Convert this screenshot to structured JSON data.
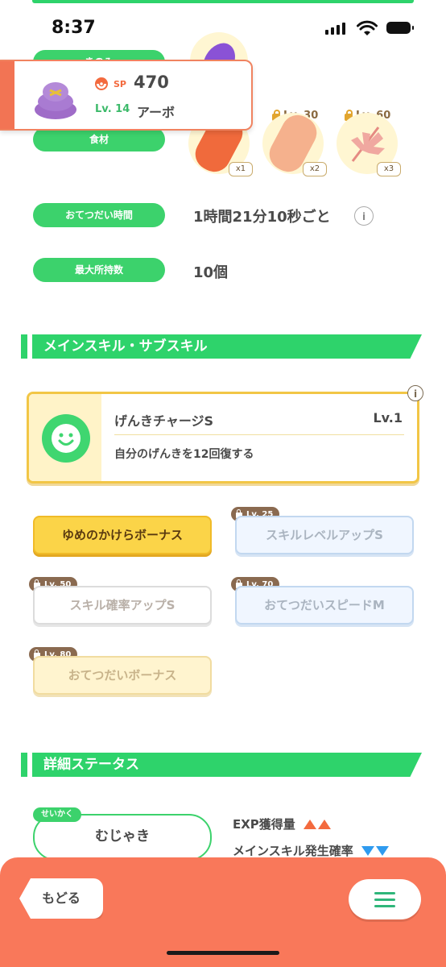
{
  "status_bar": {
    "time": "8:37"
  },
  "popup": {
    "sp_label": "SP",
    "sp_value": "470",
    "level": "Lv. 14",
    "name": "アーボ"
  },
  "info": {
    "label_top": "きのみ",
    "ingredients_label": "食材",
    "help_time_label": "おてつだい時間",
    "help_time_value": "1時間21分10秒ごと",
    "max_carry_label": "最大所持数",
    "max_carry_value": "10個"
  },
  "ingredients": [
    {
      "lock_label": "",
      "qty": "x1",
      "color": "#f06a3c",
      "icon": "sausage-icon"
    },
    {
      "lock_label": "Lv. 30",
      "qty": "x2",
      "color": "#f3a07c",
      "icon": "sausage-icon"
    },
    {
      "lock_label": "Lv. 60",
      "qty": "x3",
      "color": "#f0a8a0",
      "icon": "herb-icon"
    }
  ],
  "section_skill": {
    "title": "メインスキル・サブスキル"
  },
  "main_skill": {
    "name": "げんきチャージS",
    "level": "Lv.1",
    "description": "自分のげんきを12回復する",
    "info_glyph": "i"
  },
  "sub_skills": [
    {
      "label": "ゆめのかけらボーナス",
      "lock": "",
      "style": "active"
    },
    {
      "label": "スキルレベルアップS",
      "lock": "Lv. 25",
      "style": "blue"
    },
    {
      "label": "スキル確率アップS",
      "lock": "Lv. 50",
      "style": "white"
    },
    {
      "label": "おてつだいスピードM",
      "lock": "Lv. 70",
      "style": "blue"
    },
    {
      "label": "おてつだいボーナス",
      "lock": "Lv. 80",
      "style": "yellow"
    }
  ],
  "section_status": {
    "title": "詳細ステータス"
  },
  "nature": {
    "tag": "せいかく",
    "value": "むじゃき",
    "effects": [
      {
        "label": "EXP獲得量",
        "direction": "up",
        "color": "#f36a3e"
      },
      {
        "label": "メインスキル発生確率",
        "direction": "down",
        "color": "#2f9bef"
      }
    ]
  },
  "bottom_bar": {
    "back_label": "もどる",
    "menu_icon": "hamburger-icon"
  },
  "colors": {
    "accent_green": "#2ed36b",
    "bottom_bar": "#f9785a",
    "gold": "#f2c646"
  }
}
